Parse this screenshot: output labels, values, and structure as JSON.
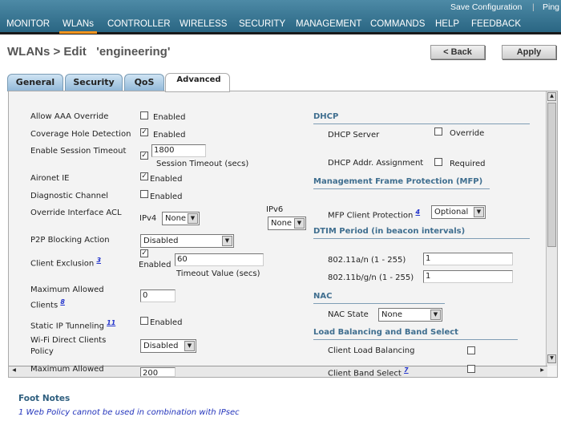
{
  "top_links": [
    "Save Configuration",
    "Ping"
  ],
  "nav": [
    "MONITOR",
    "WLANs",
    "CONTROLLER",
    "WIRELESS",
    "SECURITY",
    "MANAGEMENT",
    "COMMANDS",
    "HELP",
    "FEEDBACK"
  ],
  "title": "WLANs > Edit   'engineering'",
  "buttons": {
    "back": "< Back",
    "apply": "Apply"
  },
  "tabs": [
    "General",
    "Security",
    "QoS",
    "Advanced"
  ],
  "left": {
    "aaa": {
      "label": "Allow AAA Override",
      "check": "Enabled",
      "checked": false
    },
    "chd": {
      "label": "Coverage Hole Detection",
      "check": "Enabled",
      "checked": true
    },
    "est": {
      "label": "Enable Session Timeout",
      "value": "1800",
      "sub": "Session Timeout (secs)",
      "checked": true
    },
    "aironet": {
      "label": "Aironet IE",
      "check": "Enabled",
      "checked": true
    },
    "diag": {
      "label": "Diagnostic Channel",
      "check": "Enabled",
      "checked": false
    },
    "acl": {
      "label": "Override Interface ACL",
      "ipv4": "IPv4",
      "ipv4_val": "None",
      "ipv6": "IPv6",
      "ipv6_val": "None"
    },
    "p2p": {
      "label": "P2P Blocking Action",
      "value": "Disabled"
    },
    "excl": {
      "label": "Client Exclusion",
      "fn": "3",
      "check": "Enabled",
      "value": "60",
      "sub": "Timeout Value (secs)",
      "checked": true
    },
    "maxc": {
      "label1": "Maximum Allowed",
      "label2": "Clients",
      "fn": "8",
      "value": "0"
    },
    "sipt": {
      "label": "Static IP Tunneling",
      "fn": "11",
      "check": "Enabled",
      "checked": false
    },
    "wifid": {
      "label1": "Wi-Fi Direct Clients",
      "label2": "Policy",
      "value": "Disabled"
    },
    "maxap": {
      "label": "Maximum Allowed",
      "value": "200"
    }
  },
  "right": {
    "dhcp": "DHCP",
    "dhcp_server": {
      "label": "DHCP Server",
      "check": "Override",
      "checked": false
    },
    "dhcp_addr": {
      "label": "DHCP Addr. Assignment",
      "check": "Required",
      "checked": false
    },
    "mfp": "Management Frame Protection (MFP)",
    "mfp_client": {
      "label": "MFP Client Protection",
      "fn": "4",
      "value": "Optional"
    },
    "dtim": "DTIM Period (in beacon intervals)",
    "dtim_a": {
      "label": "802.11a/n (1 - 255)",
      "value": "1"
    },
    "dtim_b": {
      "label": "802.11b/g/n (1 - 255)",
      "value": "1"
    },
    "nac": "NAC",
    "nac_state": {
      "label": "NAC State",
      "value": "None"
    },
    "lb": "Load Balancing and Band Select",
    "clb": {
      "label": "Client Load Balancing",
      "checked": false
    },
    "cbs": {
      "label": "Client Band Select",
      "fn": "7",
      "checked": false
    }
  },
  "footnotes": {
    "title": "Foot Notes",
    "items": [
      "1 Web Policy cannot be used in combination with IPsec"
    ]
  }
}
